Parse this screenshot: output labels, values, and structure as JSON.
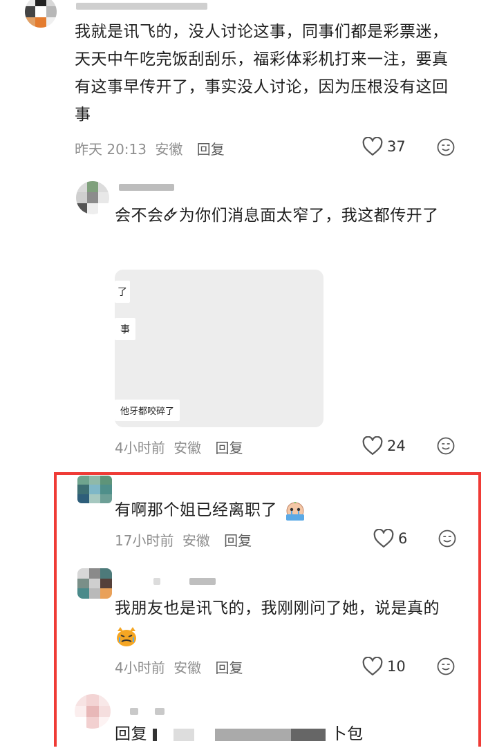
{
  "comments": [
    {
      "text": "我就是讯飞的，没人讨论这事，同事们都是彩票迷，天天中午吃完饭刮刮乐，福彩体彩机打来一注，要真有这事早传开了，事实没人讨论，因为压根没有这回事",
      "time": "昨天 20:13",
      "location": "安徽",
      "reply_label": "回复",
      "likes": "37"
    },
    {
      "text": "会不会🜸为你们消息面太窄了，我这都传开了",
      "image_snippets": [
        "了",
        "事",
        "他牙都咬碎了"
      ],
      "time": "4小时前",
      "location": "安徽",
      "reply_label": "回复",
      "likes": "24"
    },
    {
      "text": "有啊那个姐已经离职了",
      "time": "17小时前",
      "location": "安徽",
      "reply_label": "回复",
      "likes": "6"
    },
    {
      "text": "我朋友也是讯飞的，我刚刚问了她，说是真的",
      "time": "4小时前",
      "location": "安徽",
      "reply_label": "回复",
      "likes": "10"
    },
    {
      "text": "回复",
      "text_tail": "卜包"
    }
  ],
  "colors": {
    "highlight_border": "#ef3b36",
    "meta_text": "#8e8e8e",
    "body_text": "#1e1e1e"
  },
  "icons": {
    "like": "heart-outline-icon",
    "emoji": "smiley-face-icon"
  }
}
